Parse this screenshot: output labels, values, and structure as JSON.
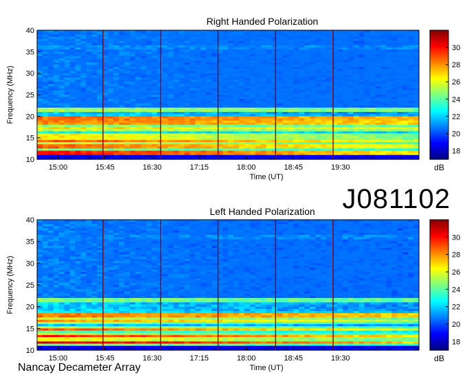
{
  "figure": {
    "id_label": "J081102",
    "footer": "Nancay Decameter Array"
  },
  "colors": {
    "colormap": [
      "#00007f",
      "#0000ff",
      "#0080ff",
      "#00ffff",
      "#80ff80",
      "#ffff00",
      "#ff8000",
      "#ff0000",
      "#7f0000"
    ],
    "marker_line": "#8b0000"
  },
  "chart_data": [
    {
      "type": "heatmap",
      "title": "Right Handed Polarization",
      "xlabel": "Time (UT)",
      "ylabel": "Frequency (MHz)",
      "x_ticks": [
        "15:00",
        "15:45",
        "16:30",
        "17:15",
        "18:00",
        "18:45",
        "19:30"
      ],
      "y_ticks": [
        "10",
        "15",
        "20",
        "25",
        "30",
        "35",
        "40"
      ],
      "ylim": [
        10,
        40
      ],
      "xlim": [
        "14:40",
        "20:45"
      ],
      "colorbar": {
        "label": "dB",
        "ticks": [
          "18",
          "20",
          "22",
          "24",
          "26",
          "28",
          "30"
        ],
        "range": [
          17,
          32
        ]
      },
      "markers_ut": [
        "15:43",
        "16:38",
        "17:33",
        "18:28",
        "19:23"
      ],
      "bands": [
        {
          "f": 11.5,
          "w": 0.8,
          "db": 31
        },
        {
          "f": 13.0,
          "w": 0.7,
          "db": 30
        },
        {
          "f": 14.3,
          "w": 0.8,
          "db": 29
        },
        {
          "f": 15.5,
          "w": 0.6,
          "db": 28
        },
        {
          "f": 17.2,
          "w": 0.9,
          "db": 27
        },
        {
          "f": 18.5,
          "w": 0.8,
          "db": 29
        },
        {
          "f": 19.5,
          "w": 0.5,
          "db": 31
        },
        {
          "f": 21.5,
          "w": 0.3,
          "db": 30
        },
        {
          "f": 36.0,
          "w": 0.2,
          "db": 24
        }
      ]
    },
    {
      "type": "heatmap",
      "title": "Left Handed Polarization",
      "xlabel": "Time (UT)",
      "ylabel": "Frequency (MHz)",
      "x_ticks": [
        "15:00",
        "15:45",
        "16:30",
        "17:15",
        "18:00",
        "18:45",
        "19:30"
      ],
      "y_ticks": [
        "10",
        "15",
        "20",
        "25",
        "30",
        "35",
        "40"
      ],
      "ylim": [
        10,
        40
      ],
      "xlim": [
        "14:40",
        "20:45"
      ],
      "colorbar": {
        "label": "dB",
        "ticks": [
          "18",
          "20",
          "22",
          "24",
          "26",
          "28",
          "30"
        ],
        "range": [
          17,
          32
        ]
      },
      "markers_ut": [
        "15:43",
        "16:38",
        "17:33",
        "18:28",
        "19:23"
      ],
      "bands": [
        {
          "f": 11.8,
          "w": 0.6,
          "db": 31
        },
        {
          "f": 13.2,
          "w": 0.7,
          "db": 30
        },
        {
          "f": 14.8,
          "w": 0.6,
          "db": 29
        },
        {
          "f": 16.8,
          "w": 0.8,
          "db": 28
        },
        {
          "f": 18.0,
          "w": 0.6,
          "db": 30
        },
        {
          "f": 21.5,
          "w": 0.3,
          "db": 29
        },
        {
          "f": 36.0,
          "w": 0.2,
          "db": 24
        }
      ]
    }
  ]
}
